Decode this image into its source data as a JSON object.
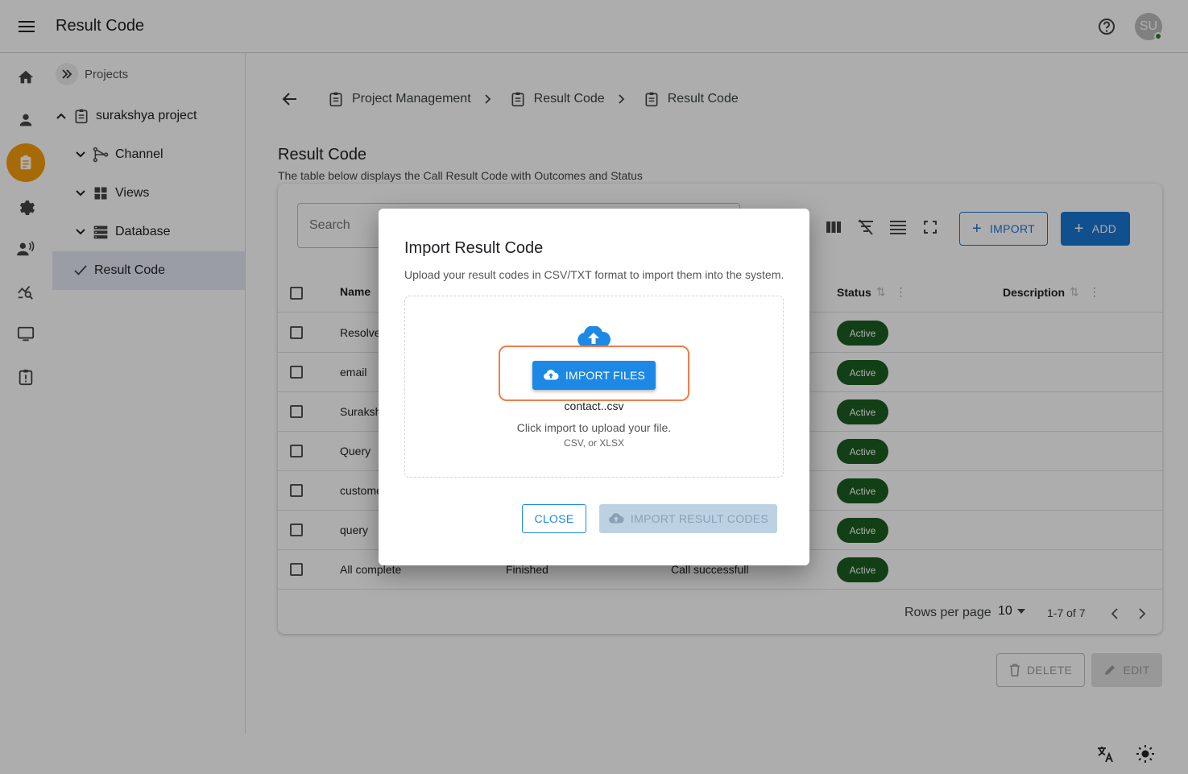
{
  "appbar": {
    "title": "Result Code",
    "avatar_initials": "SU"
  },
  "tree": {
    "header": "Projects",
    "items": [
      {
        "label": "surakshya project"
      },
      {
        "label": "Channel"
      },
      {
        "label": "Views"
      },
      {
        "label": "Database"
      },
      {
        "label": "Result Code"
      }
    ]
  },
  "breadcrumb": [
    "Project Management",
    "Result Code",
    "Result Code"
  ],
  "page": {
    "title": "Result Code",
    "subtitle": "The table below displays the Call Result Code with Outcomes and Status"
  },
  "toolbar": {
    "search_placeholder": "Search",
    "import_label": "IMPORT",
    "add_label": "ADD"
  },
  "table": {
    "columns": [
      "Name",
      "Status",
      "Description"
    ],
    "rows": [
      {
        "name": "Resolve",
        "c2": "",
        "c3": "",
        "status": "Active"
      },
      {
        "name": "email",
        "c2": "",
        "c3": "",
        "status": "Active"
      },
      {
        "name": "Suraksh",
        "c2": "",
        "c3": "",
        "status": "Active"
      },
      {
        "name": "Query",
        "c2": "",
        "c3": "",
        "status": "Active"
      },
      {
        "name": "custome",
        "c2": "",
        "c3": "",
        "status": "Active"
      },
      {
        "name": "query",
        "c2": "",
        "c3": "",
        "status": "Active"
      },
      {
        "name": "All complete",
        "c2": "Finished",
        "c3": "Call successfull",
        "status": "Active"
      }
    ]
  },
  "pager": {
    "rows_per_page_label": "Rows per page",
    "rows_per_page": "10",
    "range": "1-7 of 7"
  },
  "actions": {
    "delete_label": "DELETE",
    "edit_label": "EDIT"
  },
  "dialog": {
    "title": "Import Result Code",
    "subtitle": "Upload your result codes in CSV/TXT format to import them into the system.",
    "import_files_label": "IMPORT FILES",
    "file_name": "contact..csv",
    "hint": "Click import to upload your file.",
    "formats": "CSV, or XLSX",
    "close_label": "CLOSE",
    "import_codes_label": "IMPORT RESULT CODES"
  },
  "colors": {
    "primary": "#1976d2",
    "rail_active": "#f59e0b",
    "status_active": "#1b5e20",
    "highlight": "#ef7d4d"
  }
}
